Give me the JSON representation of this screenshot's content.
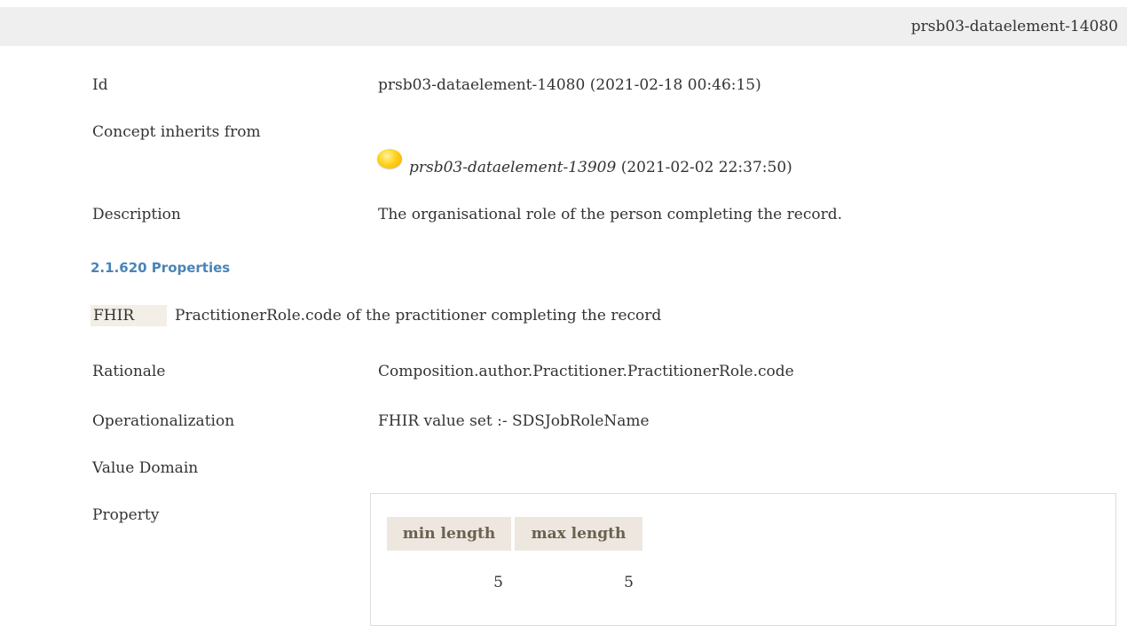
{
  "header": {
    "element_id": "prsb03-dataelement-14080"
  },
  "concept": {
    "id_label": "Id",
    "id_value": "prsb03-dataelement-14080 (2021-02-18 00:46:15)",
    "inherits_label": "Concept inherits from",
    "inherits_link": "prsb03-dataelement-13909",
    "inherits_date": "(2021-02-02 22:37:50)",
    "inherits_icon": "yellow-status-dot-icon",
    "description_label": "Description",
    "description_value": "The organisational role of the person completing the record."
  },
  "properties": {
    "heading": "2.1.620 Properties",
    "fhir_badge": "FHIR",
    "fhir_text": "PractitionerRole.code of the practitioner completing the record",
    "rationale_label": "Rationale",
    "rationale_value": "Composition.author.Practitioner.PractitionerRole.code",
    "operationalization_label": "Operationalization",
    "operationalization_value": "FHIR value set :- SDSJobRoleName",
    "value_domain_label": "Value Domain",
    "property_label": "Property",
    "table": {
      "headers": [
        "min length",
        "max length"
      ],
      "values": [
        "5",
        "5"
      ]
    }
  },
  "colors": {
    "topbar_bg": "#efefef",
    "heading": "#4a84b8",
    "table_header_bg": "#ede7e0",
    "table_header_text": "#6b6150",
    "badge_bg": "#f3eee6"
  }
}
